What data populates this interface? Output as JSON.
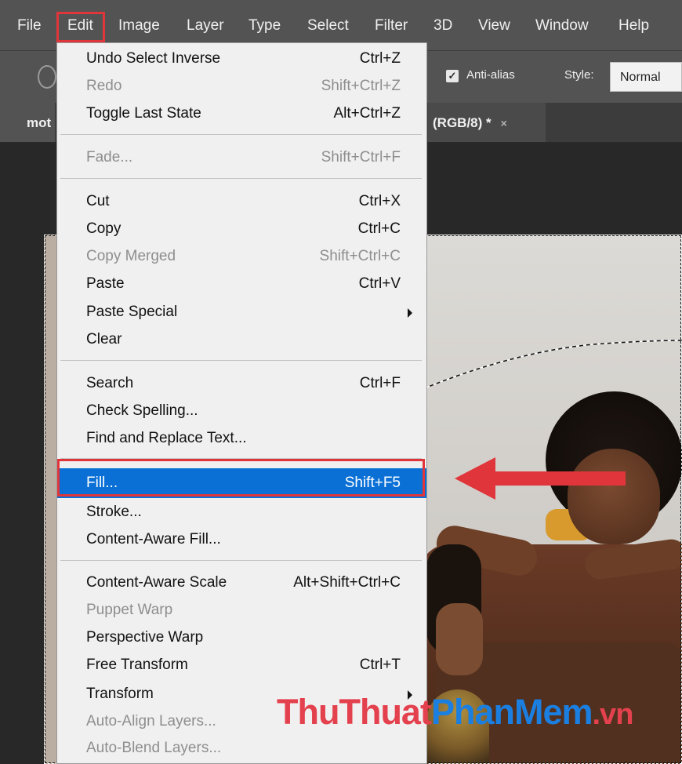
{
  "menubar": {
    "items": [
      "File",
      "Edit",
      "Image",
      "Layer",
      "Type",
      "Select",
      "Filter",
      "3D",
      "View",
      "Window",
      "Help"
    ],
    "active": "Edit"
  },
  "options": {
    "antialias_label": "Anti-alias",
    "antialias_checked": true,
    "style_label": "Style:",
    "style_value": "Normal"
  },
  "tabs": {
    "left_label": "mot",
    "active_label": "(RGB/8) *",
    "close_glyph": "×"
  },
  "edit_menu": {
    "items": [
      {
        "label": "Undo Select Inverse",
        "shortcut": "Ctrl+Z"
      },
      {
        "label": "Redo",
        "shortcut": "Shift+Ctrl+Z",
        "disabled": true
      },
      {
        "label": "Toggle Last State",
        "shortcut": "Alt+Ctrl+Z"
      },
      {
        "label": "Fade...",
        "shortcut": "Shift+Ctrl+F",
        "disabled": true
      },
      {
        "label": "Cut",
        "shortcut": "Ctrl+X"
      },
      {
        "label": "Copy",
        "shortcut": "Ctrl+C"
      },
      {
        "label": "Copy Merged",
        "shortcut": "Shift+Ctrl+C",
        "disabled": true
      },
      {
        "label": "Paste",
        "shortcut": "Ctrl+V"
      },
      {
        "label": "Paste Special",
        "shortcut": "",
        "submenu": true
      },
      {
        "label": "Clear",
        "shortcut": ""
      },
      {
        "label": "Search",
        "shortcut": "Ctrl+F"
      },
      {
        "label": "Check Spelling...",
        "shortcut": ""
      },
      {
        "label": "Find and Replace Text...",
        "shortcut": ""
      },
      {
        "label": "Fill...",
        "shortcut": "Shift+F5",
        "highlighted": true
      },
      {
        "label": "Stroke...",
        "shortcut": ""
      },
      {
        "label": "Content-Aware Fill...",
        "shortcut": ""
      },
      {
        "label": "Content-Aware Scale",
        "shortcut": "Alt+Shift+Ctrl+C"
      },
      {
        "label": "Puppet Warp",
        "shortcut": "",
        "disabled": true
      },
      {
        "label": "Perspective Warp",
        "shortcut": ""
      },
      {
        "label": "Free Transform",
        "shortcut": "Ctrl+T"
      },
      {
        "label": "Transform",
        "shortcut": "",
        "submenu": true
      },
      {
        "label": "Auto-Align Layers...",
        "shortcut": "",
        "disabled": true
      },
      {
        "label": "Auto-Blend Layers...",
        "shortcut": "",
        "disabled": true
      }
    ]
  },
  "watermark": {
    "part1": "ThuThuat",
    "part2": "PhanMem",
    "part3": ".vn"
  },
  "colors": {
    "highlight": "#0a70d6",
    "annotation_red": "#e0363b",
    "menubar_bg": "#535353"
  }
}
